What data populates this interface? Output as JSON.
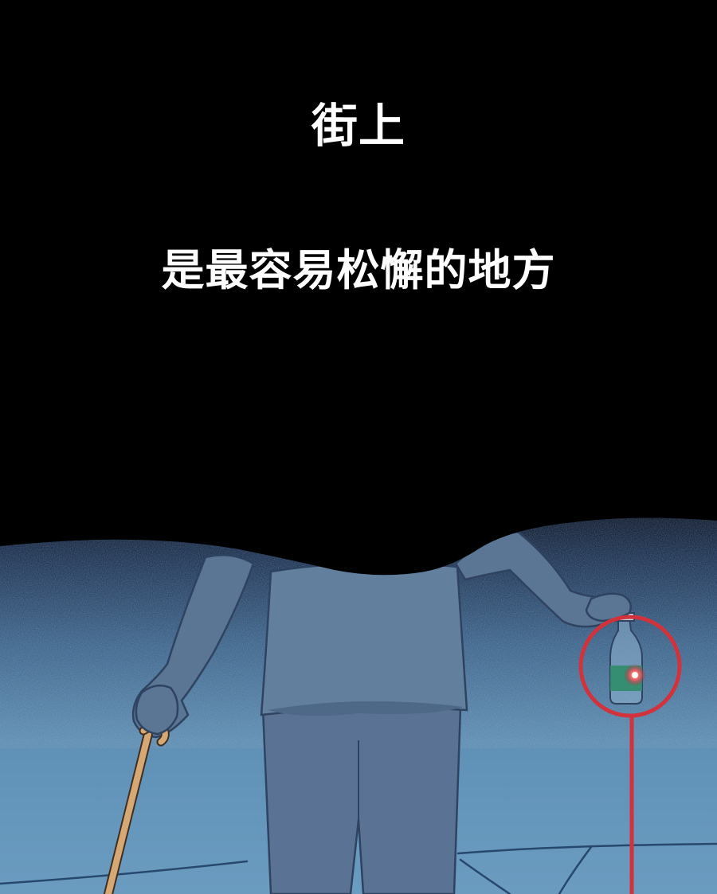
{
  "captions": {
    "line1": "街上",
    "line2": "是最容易松懈的地方"
  },
  "colors": {
    "background": "#000000",
    "caption_text": "#ffffff",
    "ground": "#6699bb",
    "figure": "#5f7a98",
    "cane": "#d6a873",
    "highlight_circle": "#d2323c",
    "bottle_liquid": "#2f8c6a"
  },
  "icons": {
    "highlight_marker": "red-circle-marker"
  }
}
